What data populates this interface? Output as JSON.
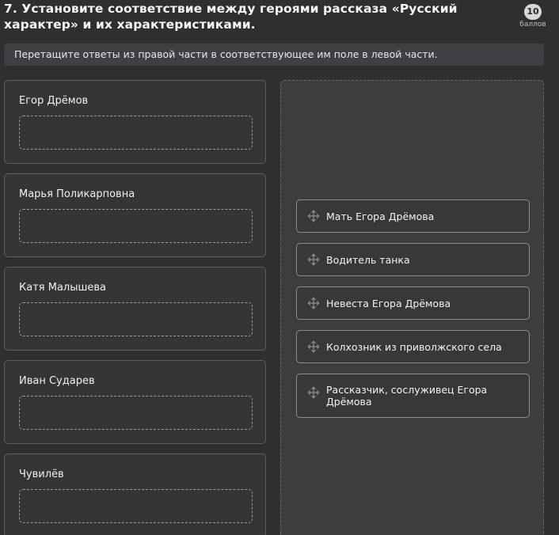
{
  "question": {
    "title": "7. Установите соответствие между героями рассказа «Русский характер» и их характеристиками.",
    "points_value": "10",
    "points_label": "баллов",
    "instruction": "Перетащите ответы из правой части в соответствующее им поле в левой части."
  },
  "characters": [
    {
      "label": "Егор Дрёмов"
    },
    {
      "label": "Марья Поликарповна"
    },
    {
      "label": "Катя Малышева"
    },
    {
      "label": "Иван Сударев"
    },
    {
      "label": "Чувилёв"
    }
  ],
  "answers": [
    {
      "label": "Мать Егора Дрёмова",
      "icon": "move-icon"
    },
    {
      "label": "Водитель танка",
      "icon": "move-icon"
    },
    {
      "label": "Невеста Егора Дрёмова",
      "icon": "move-icon"
    },
    {
      "label": "Колхозник из приволжского села",
      "icon": "move-icon"
    },
    {
      "label": "Рассказчик, сослуживец Егора Дрёмова",
      "icon": "move-icon"
    }
  ],
  "colors": {
    "background": "#2f2f30",
    "card_border": "#5d5d5f",
    "answer_border": "#8c8c8e",
    "instruction_bg": "#404044",
    "badge_bg": "#d8d8d8"
  }
}
